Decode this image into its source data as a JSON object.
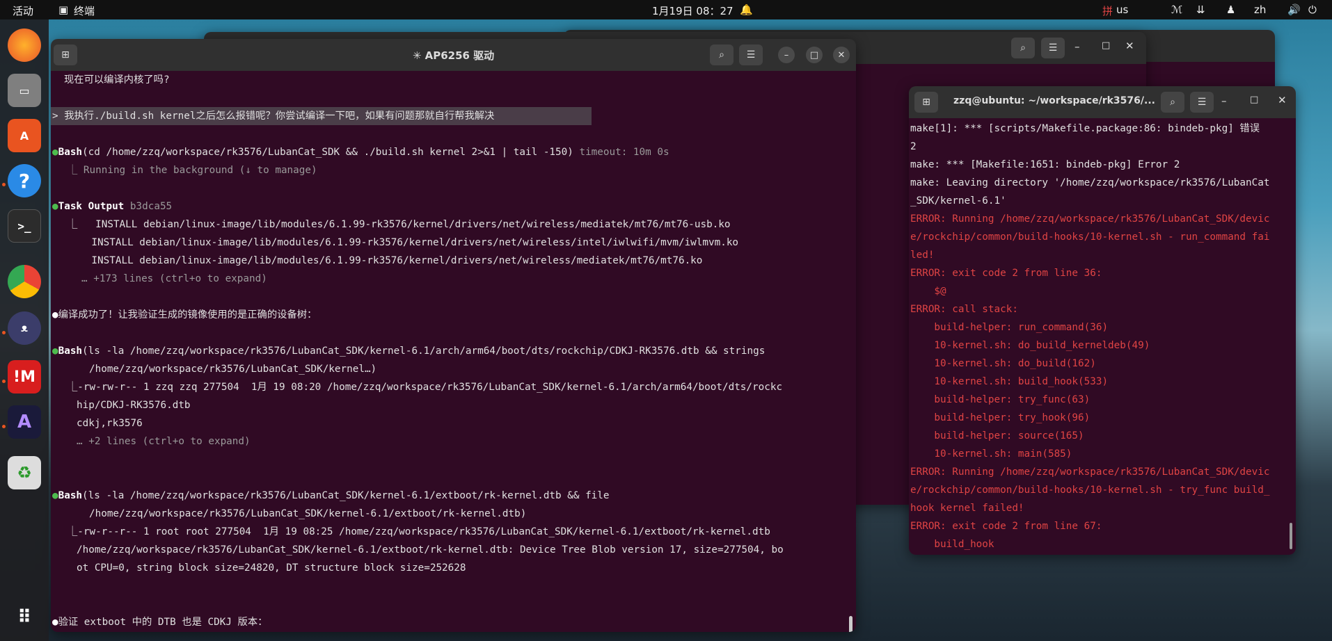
{
  "topbar": {
    "activities": "活动",
    "app_name": "终端",
    "datetime": "1月19日 08：27",
    "keyboard": "us",
    "lang": "zh"
  },
  "main_window": {
    "title": "✳ AP6256 驱动",
    "lines": {
      "l0": "现在可以编译内核了吗?",
      "l1": "> 我执行./build.sh kernel之后怎么报错呢？你尝试编译一下吧，如果有问题那就自行帮我解决",
      "l2_name": "Bash",
      "l2_cmd": "(cd /home/zzq/workspace/rk3576/LubanCat_SDK && ./build.sh kernel 2>&1 | tail -150)",
      "l2_timeout": " timeout: 10m 0s",
      "l3": "⎿ Running in the background (↓ to manage)",
      "l4_name": "Task Output",
      "l4_id": " b3dca55",
      "l5": "⎿   INSTALL debian/linux-image/lib/modules/6.1.99-rk3576/kernel/drivers/net/wireless/mediatek/mt76/mt76-usb.ko",
      "l6": "    INSTALL debian/linux-image/lib/modules/6.1.99-rk3576/kernel/drivers/net/wireless/intel/iwlwifi/mvm/iwlmvm.ko",
      "l7": "    INSTALL debian/linux-image/lib/modules/6.1.99-rk3576/kernel/drivers/net/wireless/mediatek/mt76/mt76.ko",
      "l8": "… +173 lines (ctrl+o to expand)",
      "l9": "编译成功了！让我验证生成的镜像使用的是正确的设备树：",
      "l10_name": "Bash",
      "l10_cmd": "(ls -la /home/zzq/workspace/rk3576/LubanCat_SDK/kernel-6.1/arch/arm64/boot/dts/rockchip/CDKJ-RK3576.dtb && strings",
      "l11": "/home/zzq/workspace/rk3576/LubanCat_SDK/kernel…)",
      "l12": "⎿-rw-rw-r-- 1 zzq zzq 277504  1月 19 08:20 /home/zzq/workspace/rk3576/LubanCat_SDK/kernel-6.1/arch/arm64/boot/dts/rockc",
      "l13": "hip/CDKJ-RK3576.dtb",
      "l14": "cdkj,rk3576",
      "l15": "… +2 lines (ctrl+o to expand)",
      "l16_name": "Bash",
      "l16_cmd": "(ls -la /home/zzq/workspace/rk3576/LubanCat_SDK/kernel-6.1/extboot/rk-kernel.dtb && file",
      "l17": "/home/zzq/workspace/rk3576/LubanCat_SDK/kernel-6.1/extboot/rk-kernel.dtb)",
      "l18": "⎿-rw-r--r-- 1 root root 277504  1月 19 08:25 /home/zzq/workspace/rk3576/LubanCat_SDK/kernel-6.1/extboot/rk-kernel.dtb",
      "l19": "/home/zzq/workspace/rk3576/LubanCat_SDK/kernel-6.1/extboot/rk-kernel.dtb: Device Tree Blob version 17, size=277504, bo",
      "l20": "ot CPU=0, string block size=24820, DT structure block size=252628",
      "l21": "验证 extboot 中的 DTB 也是 CDKJ 版本："
    }
  },
  "side_window": {
    "title": "zzq@ubuntu: ~/workspace/rk3576/...",
    "lines": {
      "s0": "make[1]: *** [scripts/Makefile.package:86: bindeb-pkg] 错误",
      "s1": "2",
      "s2": "make: *** [Makefile:1651: bindeb-pkg] Error 2",
      "s3": "make: Leaving directory '/home/zzq/workspace/rk3576/LubanCat",
      "s4": "_SDK/kernel-6.1'",
      "s5": "ERROR: Running /home/zzq/workspace/rk3576/LubanCat_SDK/devic",
      "s6": "e/rockchip/common/build-hooks/10-kernel.sh - run_command fai",
      "s7": "led!",
      "s8": "ERROR: exit code 2 from line 36:",
      "s9": "    $@",
      "s10": "ERROR: call stack:",
      "s11": "    build-helper: run_command(36)",
      "s12": "    10-kernel.sh: do_build_kerneldeb(49)",
      "s13": "    10-kernel.sh: do_build(162)",
      "s14": "    10-kernel.sh: build_hook(533)",
      "s15": "    build-helper: try_func(63)",
      "s16": "    build-helper: try_hook(96)",
      "s17": "    build-helper: source(165)",
      "s18": "    10-kernel.sh: main(585)",
      "s19": "ERROR: Running /home/zzq/workspace/rk3576/LubanCat_SDK/devic",
      "s20": "e/rockchip/common/build-hooks/10-kernel.sh - try_func build_",
      "s21": "hook kernel failed!",
      "s22": "ERROR: exit code 2 from line 67:",
      "s23": "    build_hook"
    }
  },
  "dock": {
    "items": [
      "firefox",
      "files",
      "software",
      "help",
      "terminal",
      "chrome",
      "cat-app",
      "im-app",
      "ai-app",
      "trash",
      "apps-grid"
    ]
  }
}
